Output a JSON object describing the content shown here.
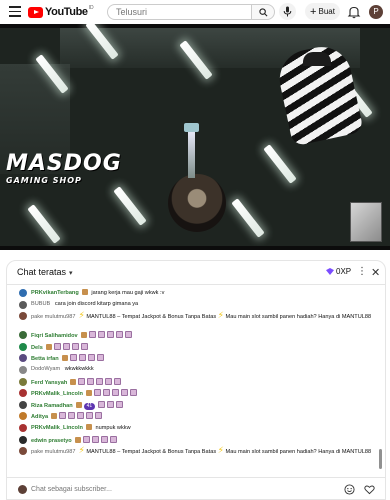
{
  "masthead": {
    "logo_text": "YouTube",
    "country_code": "ID",
    "search_placeholder": "Telusuri",
    "create_label": "Buat",
    "avatar_initial": "P"
  },
  "video": {
    "shop_logo_line1": "MASDOG",
    "shop_logo_line2": "GAMING SHOP"
  },
  "chat": {
    "title": "Chat teratas",
    "xp_label": "0XP",
    "input_placeholder": "Chat sebagai subscriber...",
    "messages": [
      {
        "author": "PRKvikanTerbang",
        "text": "jarang kerja mau gaji wkwk :v",
        "emoji": 0,
        "member": true,
        "avatar_color": "#2f6db0"
      },
      {
        "author": "BUBUB",
        "text": "cara join discord kitarp gimana ya",
        "emoji": 0,
        "member": false,
        "avatar_color": "#5a5a5a"
      },
      {
        "author": "pake mulutmu987",
        "text": "MANTUL88 – Tempat Jackpot & Bonus Tanpa Batas",
        "text2": "Mau main slot sambil panen hadiah? Hanya di MANTUL88",
        "emoji": 0,
        "member": false,
        "avatar_color": "#7a4a3a",
        "promo": true
      },
      {
        "author": "Fiqri Salihamidov",
        "text": "",
        "emoji": 5,
        "member": true,
        "avatar_color": "#3a6b38"
      },
      {
        "author": "Dels",
        "text": "",
        "emoji": 4,
        "member": true,
        "avatar_color": "#1f8a4a"
      },
      {
        "author": "Betta irfan",
        "text": "",
        "emoji": 4,
        "member": true,
        "avatar_color": "#5a4a80"
      },
      {
        "author": "DodoWyam",
        "text": "wkwkkwkkk",
        "emoji": 0,
        "member": false,
        "avatar_color": "#888888"
      },
      {
        "author": "Ferd Yansyah",
        "text": "",
        "emoji": 5,
        "member": true,
        "avatar_color": "#7a7a3a"
      },
      {
        "author": "PRKvMalik_Lincoln",
        "text": "",
        "emoji": 5,
        "member": true,
        "avatar_color": "#a83232"
      },
      {
        "author": "Riza Ramadhan",
        "text": "",
        "emoji": 3,
        "member": true,
        "avatar_color": "#444444",
        "gift_count": "41"
      },
      {
        "author": "Aditya",
        "text": "",
        "emoji": 5,
        "member": true,
        "avatar_color": "#c07a2a"
      },
      {
        "author": "PRKvMalik_Lincoln",
        "text": "numpuk wkkw",
        "emoji": 0,
        "member": true,
        "avatar_color": "#a83232"
      },
      {
        "author": "edwin prasetyo",
        "text": "",
        "emoji": 4,
        "member": true,
        "avatar_color": "#2a2a2a"
      },
      {
        "author": "pake mulutmu987",
        "text": "MANTUL88 – Tempat Jackpot & Bonus Tanpa Batas",
        "text2": "Mau main slot sambil panen hadiah? Hanya di MANTUL88",
        "emoji": 0,
        "member": false,
        "avatar_color": "#7a4a3a",
        "promo": true
      }
    ]
  }
}
